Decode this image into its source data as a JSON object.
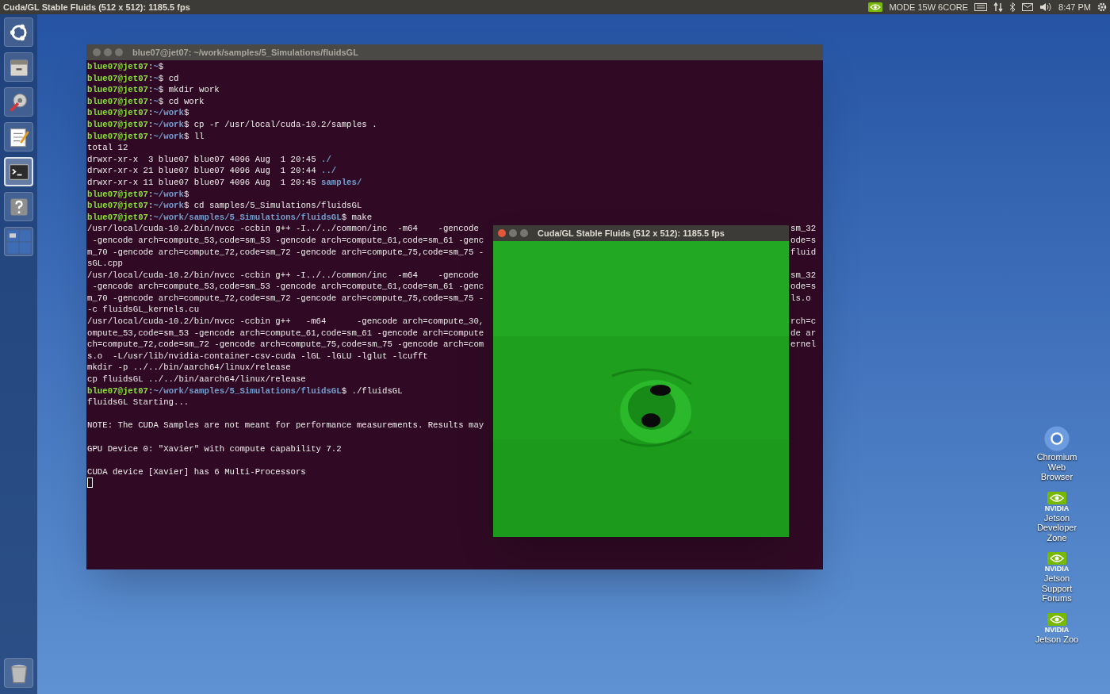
{
  "top_bar": {
    "title": "Cuda/GL Stable Fluids (512 x 512): 1185.5 fps",
    "mode": "MODE 15W 6CORE",
    "time": "8:47 PM"
  },
  "launcher": [
    {
      "kind": "dash",
      "active": false
    },
    {
      "kind": "files",
      "active": false
    },
    {
      "kind": "settings",
      "active": false
    },
    {
      "kind": "editor",
      "active": false
    },
    {
      "kind": "terminal",
      "active": true
    },
    {
      "kind": "help",
      "active": false
    },
    {
      "kind": "workspaces",
      "active": false
    },
    {
      "kind": "trash",
      "active": false
    }
  ],
  "terminal": {
    "title": "blue07@jet07: ~/work/samples/5_Simulations/fluidsGL",
    "lines": [
      {
        "kind": "text",
        "segments": [
          {
            "kind": "user",
            "text": "blue07@jet07"
          },
          {
            "kind": "plain",
            "text": ":"
          },
          {
            "kind": "path",
            "text": "~"
          },
          {
            "kind": "plain",
            "text": "$"
          }
        ]
      },
      {
        "kind": "text",
        "segments": [
          {
            "kind": "user",
            "text": "blue07@jet07"
          },
          {
            "kind": "plain",
            "text": ":"
          },
          {
            "kind": "path",
            "text": "~"
          },
          {
            "kind": "plain",
            "text": "$ cd"
          }
        ]
      },
      {
        "kind": "text",
        "segments": [
          {
            "kind": "user",
            "text": "blue07@jet07"
          },
          {
            "kind": "plain",
            "text": ":"
          },
          {
            "kind": "path",
            "text": "~"
          },
          {
            "kind": "plain",
            "text": "$ mkdir work"
          }
        ]
      },
      {
        "kind": "text",
        "segments": [
          {
            "kind": "user",
            "text": "blue07@jet07"
          },
          {
            "kind": "plain",
            "text": ":"
          },
          {
            "kind": "path",
            "text": "~"
          },
          {
            "kind": "plain",
            "text": "$ cd work"
          }
        ]
      },
      {
        "kind": "text",
        "segments": [
          {
            "kind": "user",
            "text": "blue07@jet07"
          },
          {
            "kind": "plain",
            "text": ":"
          },
          {
            "kind": "path",
            "text": "~/work"
          },
          {
            "kind": "plain",
            "text": "$"
          }
        ]
      },
      {
        "kind": "text",
        "segments": [
          {
            "kind": "user",
            "text": "blue07@jet07"
          },
          {
            "kind": "plain",
            "text": ":"
          },
          {
            "kind": "path",
            "text": "~/work"
          },
          {
            "kind": "plain",
            "text": "$ cp -r /usr/local/cuda-10.2/samples ."
          }
        ]
      },
      {
        "kind": "text",
        "segments": [
          {
            "kind": "user",
            "text": "blue07@jet07"
          },
          {
            "kind": "plain",
            "text": ":"
          },
          {
            "kind": "path",
            "text": "~/work"
          },
          {
            "kind": "plain",
            "text": "$ ll"
          }
        ]
      },
      {
        "kind": "text",
        "segments": [
          {
            "kind": "plain",
            "text": "total 12"
          }
        ]
      },
      {
        "kind": "text",
        "segments": [
          {
            "kind": "plain",
            "text": "drwxr-xr-x  3 blue07 blue07 4096 Aug  1 20:45 "
          },
          {
            "kind": "path",
            "text": "./"
          }
        ]
      },
      {
        "kind": "text",
        "segments": [
          {
            "kind": "plain",
            "text": "drwxr-xr-x 21 blue07 blue07 4096 Aug  1 20:44 "
          },
          {
            "kind": "path",
            "text": "../"
          }
        ]
      },
      {
        "kind": "text",
        "segments": [
          {
            "kind": "plain",
            "text": "drwxr-xr-x 11 blue07 blue07 4096 Aug  1 20:45 "
          },
          {
            "kind": "path",
            "text": "samples/"
          }
        ]
      },
      {
        "kind": "text",
        "segments": [
          {
            "kind": "user",
            "text": "blue07@jet07"
          },
          {
            "kind": "plain",
            "text": ":"
          },
          {
            "kind": "path",
            "text": "~/work"
          },
          {
            "kind": "plain",
            "text": "$"
          }
        ]
      },
      {
        "kind": "text",
        "segments": [
          {
            "kind": "user",
            "text": "blue07@jet07"
          },
          {
            "kind": "plain",
            "text": ":"
          },
          {
            "kind": "path",
            "text": "~/work"
          },
          {
            "kind": "plain",
            "text": "$ cd samples/5_Simulations/fluidsGL"
          }
        ]
      },
      {
        "kind": "text",
        "segments": [
          {
            "kind": "user",
            "text": "blue07@jet07"
          },
          {
            "kind": "plain",
            "text": ":"
          },
          {
            "kind": "path",
            "text": "~/work/samples/5_Simulations/fluidsGL"
          },
          {
            "kind": "plain",
            "text": "$ make"
          }
        ]
      },
      {
        "kind": "text",
        "segments": [
          {
            "kind": "plain",
            "text": "/usr/local/cuda-10.2/bin/nvcc -ccbin g++ -I../../common/inc  -m64    -gencode"
          }
        ],
        "right": "sm_32"
      },
      {
        "kind": "text",
        "segments": [
          {
            "kind": "plain",
            "text": " -gencode arch=compute_53,code=sm_53 -gencode arch=compute_61,code=sm_61 -genc"
          }
        ],
        "right": "ode=s"
      },
      {
        "kind": "text",
        "segments": [
          {
            "kind": "plain",
            "text": "m_70 -gencode arch=compute_72,code=sm_72 -gencode arch=compute_75,code=sm_75 -"
          }
        ],
        "right": "fluid"
      },
      {
        "kind": "text",
        "segments": [
          {
            "kind": "plain",
            "text": "sGL.cpp"
          }
        ]
      },
      {
        "kind": "text",
        "segments": [
          {
            "kind": "plain",
            "text": "/usr/local/cuda-10.2/bin/nvcc -ccbin g++ -I../../common/inc  -m64    -gencode"
          }
        ],
        "right": "sm_32"
      },
      {
        "kind": "text",
        "segments": [
          {
            "kind": "plain",
            "text": " -gencode arch=compute_53,code=sm_53 -gencode arch=compute_61,code=sm_61 -genc"
          }
        ],
        "right": "ode=s"
      },
      {
        "kind": "text",
        "segments": [
          {
            "kind": "plain",
            "text": "m_70 -gencode arch=compute_72,code=sm_72 -gencode arch=compute_75,code=sm_75 -"
          }
        ],
        "right": "ls.o"
      },
      {
        "kind": "text",
        "segments": [
          {
            "kind": "plain",
            "text": "-c fluidsGL_kernels.cu"
          }
        ]
      },
      {
        "kind": "text",
        "segments": [
          {
            "kind": "plain",
            "text": "/usr/local/cuda-10.2/bin/nvcc -ccbin g++   -m64      -gencode arch=compute_30,"
          }
        ],
        "right": "rch=c"
      },
      {
        "kind": "text",
        "segments": [
          {
            "kind": "plain",
            "text": "ompute_53,code=sm_53 -gencode arch=compute_61,code=sm_61 -gencode arch=compute"
          }
        ],
        "right": "de ar"
      },
      {
        "kind": "text",
        "segments": [
          {
            "kind": "plain",
            "text": "ch=compute_72,code=sm_72 -gencode arch=compute_75,code=sm_75 -gencode arch=com"
          }
        ],
        "right": "ernel"
      },
      {
        "kind": "text",
        "segments": [
          {
            "kind": "plain",
            "text": "s.o  -L/usr/lib/nvidia-container-csv-cuda -lGL -lGLU -lglut -lcufft"
          }
        ]
      },
      {
        "kind": "text",
        "segments": [
          {
            "kind": "plain",
            "text": "mkdir -p ../../bin/aarch64/linux/release"
          }
        ]
      },
      {
        "kind": "text",
        "segments": [
          {
            "kind": "plain",
            "text": "cp fluidsGL ../../bin/aarch64/linux/release"
          }
        ]
      },
      {
        "kind": "text",
        "segments": [
          {
            "kind": "user",
            "text": "blue07@jet07"
          },
          {
            "kind": "plain",
            "text": ":"
          },
          {
            "kind": "path",
            "text": "~/work/samples/5_Simulations/fluidsGL"
          },
          {
            "kind": "plain",
            "text": "$ ./fluidsGL"
          }
        ]
      },
      {
        "kind": "text",
        "segments": [
          {
            "kind": "plain",
            "text": "fluidsGL Starting..."
          }
        ]
      },
      {
        "kind": "blank"
      },
      {
        "kind": "text",
        "segments": [
          {
            "kind": "plain",
            "text": "NOTE: The CUDA Samples are not meant for performance measurements. Results may"
          }
        ]
      },
      {
        "kind": "blank"
      },
      {
        "kind": "text",
        "segments": [
          {
            "kind": "plain",
            "text": "GPU Device 0: \"Xavier\" with compute capability 7.2"
          }
        ]
      },
      {
        "kind": "blank"
      },
      {
        "kind": "text",
        "segments": [
          {
            "kind": "plain",
            "text": "CUDA device [Xavier] has 6 Multi-Processors"
          }
        ]
      },
      {
        "kind": "cursor"
      }
    ]
  },
  "fluids_window": {
    "title": "Cuda/GL Stable Fluids (512 x 512): 1185.5 fps",
    "kind": "picture"
  },
  "desktop_icons": [
    {
      "kind": "chromium",
      "lines": [
        "Chromium",
        "Web",
        "Browser"
      ]
    },
    {
      "kind": "nvidia",
      "brand": "NVIDIA",
      "lines": [
        "Jetson",
        "Developer",
        "Zone"
      ]
    },
    {
      "kind": "nvidia",
      "brand": "NVIDIA",
      "lines": [
        "Jetson",
        "Support",
        "Forums"
      ]
    },
    {
      "kind": "nvidia",
      "brand": "NVIDIA",
      "lines": [
        "Jetson Zoo"
      ]
    }
  ]
}
